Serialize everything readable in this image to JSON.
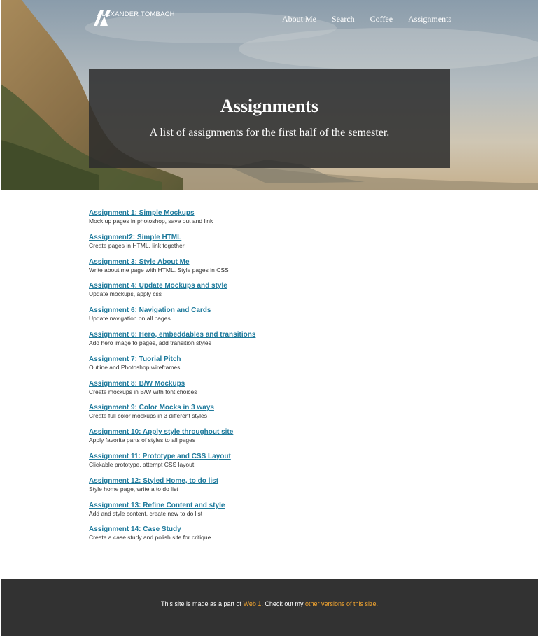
{
  "header": {
    "logo_text": "ALEXANDER TOMBACH",
    "nav": [
      "About Me",
      "Search",
      "Coffee",
      "Assignments"
    ]
  },
  "hero": {
    "title": "Assignments",
    "subtitle": "A list of assignments for the first half of the semester."
  },
  "assignments": [
    {
      "title": "Assignment 1: Simple Mockups",
      "desc": "Mock up pages in photoshop, save out and link"
    },
    {
      "title": "Assignment2: Simple HTML",
      "desc": "Create pages in HTML, link together"
    },
    {
      "title": "Assignment 3: Style About Me",
      "desc": "Write about me page with HTML. Style pages in CSS"
    },
    {
      "title": "Assignment 4: Update Mockups and style",
      "desc": "Update mockups, apply css"
    },
    {
      "title": "Assignment 6: Navigation and Cards",
      "desc": "Update navigation on all pages"
    },
    {
      "title": "Assignment 6: Hero, embeddables and transitions",
      "desc": "Add hero image to pages, add transition styles"
    },
    {
      "title": "Assignment 7: Tuorial Pitch",
      "desc": "Outline and Photoshop wireframes"
    },
    {
      "title": "Assignment 8: B/W Mockups",
      "desc": "Create mockups in B/W with font choices"
    },
    {
      "title": "Assignment 9: Color Mocks in 3 ways",
      "desc": "Create full color mockups in 3 different styles"
    },
    {
      "title": "Assignment 10: Apply style throughout site",
      "desc": "Apply favorite parts of styles to all pages"
    },
    {
      "title": "Assignment 11: Prototype and CSS Layout",
      "desc": "Clickable prototype, attempt CSS layout"
    },
    {
      "title": "Assignment 12: Styled Home, to do list",
      "desc": "Style home page, write a to do list"
    },
    {
      "title": "Assignment 13: Refine Content and style",
      "desc": "Add and style content, create new to do list"
    },
    {
      "title": "Assignment 14: Case Study",
      "desc": "Create a case study and polish site for critique"
    }
  ],
  "footer": {
    "text_before": "This site is made as a part of ",
    "link1": "Web 1",
    "text_middle": ". Check out my ",
    "link2": "other versions of this size."
  },
  "colors": {
    "link": "#1e7a9c",
    "footer_bg": "#323232",
    "footer_link": "#f4a630",
    "hero_box": "rgba(44,44,44,0.86)"
  }
}
